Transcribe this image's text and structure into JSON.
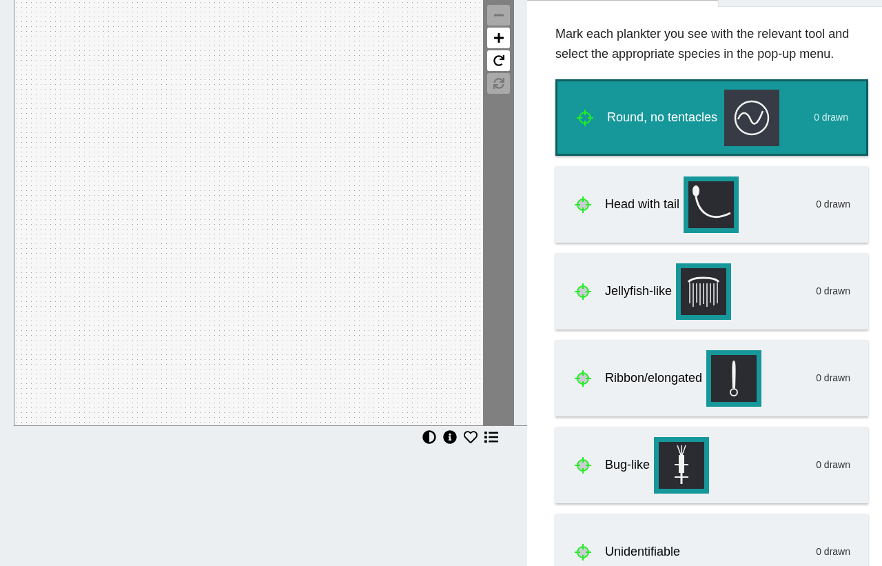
{
  "viewer": {
    "zoom_controls": [
      {
        "kind": "zoom-out",
        "disabled": true
      },
      {
        "kind": "zoom-in",
        "disabled": false
      },
      {
        "kind": "rotate",
        "disabled": false
      },
      {
        "kind": "reset",
        "disabled": true
      }
    ],
    "actions": [
      {
        "kind": "contrast"
      },
      {
        "kind": "info"
      },
      {
        "kind": "favorite"
      },
      {
        "kind": "collections"
      }
    ]
  },
  "task": {
    "instruction": "Mark each plankter you see with the relevant tool and select the appropriate species in the pop-up menu.",
    "tools": [
      {
        "label": "Round, no tentacles",
        "count": "0 drawn",
        "selected": true,
        "kind": "round"
      },
      {
        "label": "Head with tail",
        "count": "0 drawn",
        "selected": false,
        "kind": "tail"
      },
      {
        "label": "Jellyfish-like",
        "count": "0 drawn",
        "selected": false,
        "kind": "jellyfish"
      },
      {
        "label": "Ribbon/elongated",
        "count": "0 drawn",
        "selected": false,
        "kind": "ribbon"
      },
      {
        "label": "Bug-like",
        "count": "0 drawn",
        "selected": false,
        "kind": "bug"
      },
      {
        "label": "Unidentifiable",
        "count": "0 drawn",
        "selected": false,
        "kind": "none"
      }
    ]
  }
}
